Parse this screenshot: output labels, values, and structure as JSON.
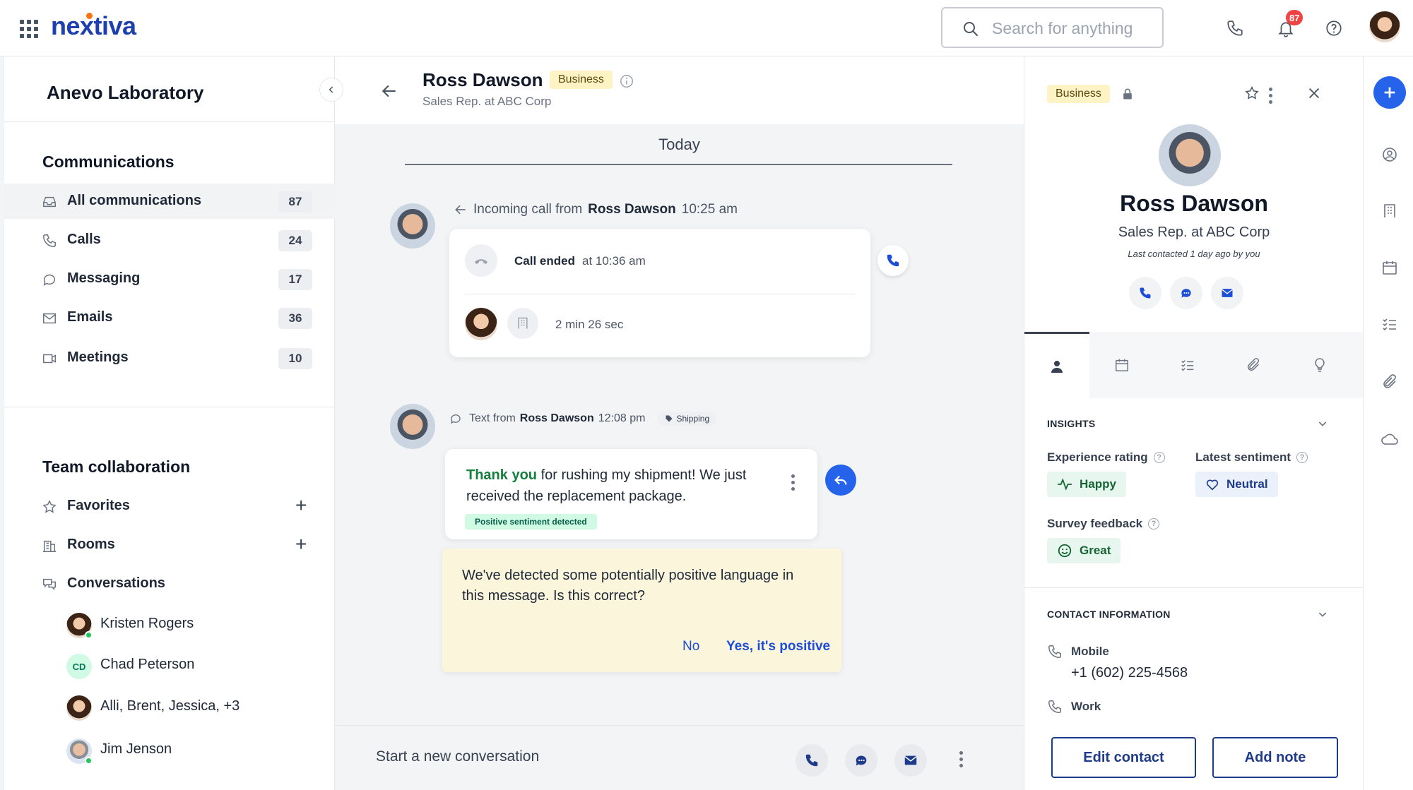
{
  "topbar": {
    "logo": "nextiva",
    "search_placeholder": "Search for anything",
    "notification_count": "87"
  },
  "sidebar": {
    "org_name": "Anevo Laboratory",
    "communications_title": "Communications",
    "communications": [
      {
        "label": "All communications",
        "count": "87"
      },
      {
        "label": "Calls",
        "count": "24"
      },
      {
        "label": "Messaging",
        "count": "17"
      },
      {
        "label": "Emails",
        "count": "36"
      },
      {
        "label": "Meetings",
        "count": "10"
      }
    ],
    "team_title": "Team collaboration",
    "team": [
      {
        "label": "Favorites"
      },
      {
        "label": "Rooms"
      },
      {
        "label": "Conversations"
      }
    ],
    "conversations": [
      {
        "name": "Kristen Rogers"
      },
      {
        "name": "Chad Peterson",
        "initials": "CD"
      },
      {
        "name": "Alli, Brent, Jessica, +3"
      },
      {
        "name": "Jim Jenson"
      }
    ]
  },
  "chat": {
    "contact_name": "Ross Dawson",
    "tag": "Business",
    "contact_title": "Sales Rep. at ABC Corp",
    "day_label": "Today",
    "call": {
      "prefix": "Incoming call from",
      "from": "Ross Dawson",
      "time": "10:25 am",
      "status": "Call ended",
      "ended_at": "at 10:36 am",
      "duration": "2 min 26 sec"
    },
    "text": {
      "prefix": "Text from",
      "from": "Ross Dawson",
      "time": "12:08 pm",
      "tag": "Shipping",
      "highlight": "Thank you",
      "body": " for rushing my shipment!  We just received the replacement package.",
      "sentiment": "Positive sentiment detected"
    },
    "detect": {
      "text": "We've detected some potentially positive language in this message. Is this correct?",
      "no_label": "No",
      "yes_label": "Yes, it's positive"
    },
    "composer_text": "Start a new conversation"
  },
  "profile": {
    "tag": "Business",
    "name": "Ross Dawson",
    "title": "Sales Rep. at ABC Corp",
    "last_contacted": "Last contacted 1 day ago by you",
    "insights_title": "INSIGHTS",
    "experience_label": "Experience rating",
    "experience_value": "Happy",
    "sentiment_label": "Latest sentiment",
    "sentiment_value": "Neutral",
    "survey_label": "Survey feedback",
    "survey_value": "Great",
    "contact_title": "CONTACT INFORMATION",
    "mobile_label": "Mobile",
    "mobile_value": "+1 (602) 225-4568",
    "work_label": "Work",
    "edit_label": "Edit contact",
    "note_label": "Add note"
  },
  "colors": {
    "brand": "#1e40af",
    "accent": "#2563eb",
    "business_tag": "#fdf3c4",
    "positive": "#15803d"
  }
}
